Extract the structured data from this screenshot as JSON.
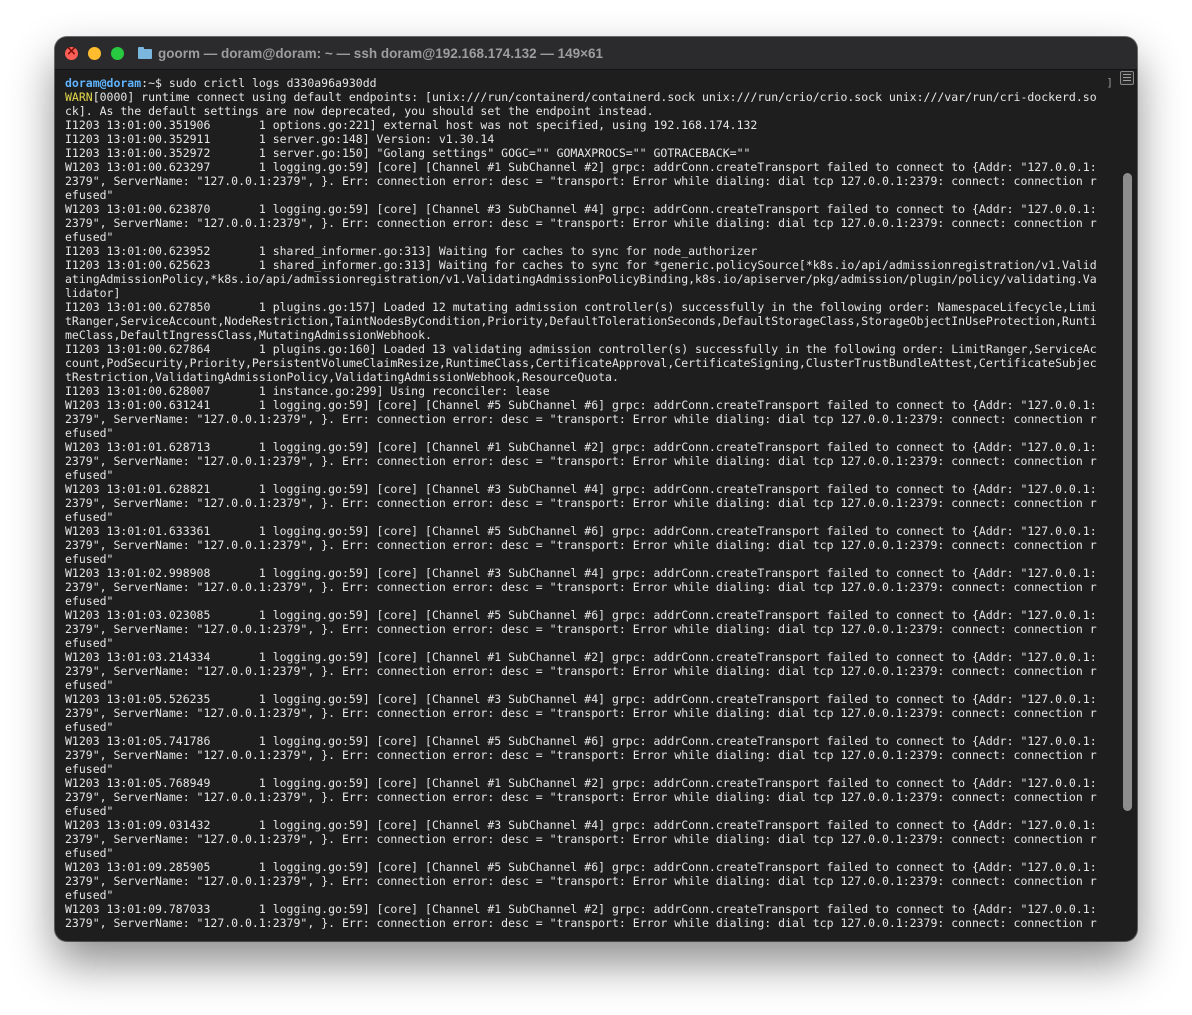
{
  "window": {
    "title": "goorm — doram@doram: ~ — ssh doram@192.168.174.132 — 149×61"
  },
  "terminal": {
    "prompt": {
      "user": "doram@doram",
      "rest": ":~$ sudo crictl logs d330a96a930dd"
    },
    "lines": [
      {
        "text": "WARN[0000] runtime connect using default endpoints: [unix:///run/containerd/containerd.sock unix:///run/crio/crio.sock unix:///var/run/cri-dockerd.so",
        "warn_prefix": "WARN",
        "rest": "[0000] runtime connect using default endpoints: [unix:///run/containerd/containerd.sock unix:///run/crio/crio.sock unix:///var/run/cri-dockerd.so"
      },
      {
        "text": "ck]. As the default settings are now deprecated, you should set the endpoint instead."
      },
      {
        "text": "I1203 13:01:00.351906       1 options.go:221] external host was not specified, using 192.168.174.132"
      },
      {
        "text": "I1203 13:01:00.352911       1 server.go:148] Version: v1.30.14"
      },
      {
        "text": "I1203 13:01:00.352972       1 server.go:150] \"Golang settings\" GOGC=\"\" GOMAXPROCS=\"\" GOTRACEBACK=\"\""
      },
      {
        "text": "W1203 13:01:00.623297       1 logging.go:59] [core] [Channel #1 SubChannel #2] grpc: addrConn.createTransport failed to connect to {Addr: \"127.0.0.1:"
      },
      {
        "text": "2379\", ServerName: \"127.0.0.1:2379\", }. Err: connection error: desc = \"transport: Error while dialing: dial tcp 127.0.0.1:2379: connect: connection r"
      },
      {
        "text": "efused\""
      },
      {
        "text": "W1203 13:01:00.623870       1 logging.go:59] [core] [Channel #3 SubChannel #4] grpc: addrConn.createTransport failed to connect to {Addr: \"127.0.0.1:"
      },
      {
        "text": "2379\", ServerName: \"127.0.0.1:2379\", }. Err: connection error: desc = \"transport: Error while dialing: dial tcp 127.0.0.1:2379: connect: connection r"
      },
      {
        "text": "efused\""
      },
      {
        "text": "I1203 13:01:00.623952       1 shared_informer.go:313] Waiting for caches to sync for node_authorizer"
      },
      {
        "text": "I1203 13:01:00.625623       1 shared_informer.go:313] Waiting for caches to sync for *generic.policySource[*k8s.io/api/admissionregistration/v1.Valid"
      },
      {
        "text": "atingAdmissionPolicy,*k8s.io/api/admissionregistration/v1.ValidatingAdmissionPolicyBinding,k8s.io/apiserver/pkg/admission/plugin/policy/validating.Va"
      },
      {
        "text": "lidator]"
      },
      {
        "text": "I1203 13:01:00.627850       1 plugins.go:157] Loaded 12 mutating admission controller(s) successfully in the following order: NamespaceLifecycle,Limi"
      },
      {
        "text": "tRanger,ServiceAccount,NodeRestriction,TaintNodesByCondition,Priority,DefaultTolerationSeconds,DefaultStorageClass,StorageObjectInUseProtection,Runti"
      },
      {
        "text": "meClass,DefaultIngressClass,MutatingAdmissionWebhook."
      },
      {
        "text": "I1203 13:01:00.627864       1 plugins.go:160] Loaded 13 validating admission controller(s) successfully in the following order: LimitRanger,ServiceAc"
      },
      {
        "text": "count,PodSecurity,Priority,PersistentVolumeClaimResize,RuntimeClass,CertificateApproval,CertificateSigning,ClusterTrustBundleAttest,CertificateSubjec"
      },
      {
        "text": "tRestriction,ValidatingAdmissionPolicy,ValidatingAdmissionWebhook,ResourceQuota."
      },
      {
        "text": "I1203 13:01:00.628007       1 instance.go:299] Using reconciler: lease"
      },
      {
        "text": "W1203 13:01:00.631241       1 logging.go:59] [core] [Channel #5 SubChannel #6] grpc: addrConn.createTransport failed to connect to {Addr: \"127.0.0.1:"
      },
      {
        "text": "2379\", ServerName: \"127.0.0.1:2379\", }. Err: connection error: desc = \"transport: Error while dialing: dial tcp 127.0.0.1:2379: connect: connection r"
      },
      {
        "text": "efused\""
      },
      {
        "text": "W1203 13:01:01.628713       1 logging.go:59] [core] [Channel #1 SubChannel #2] grpc: addrConn.createTransport failed to connect to {Addr: \"127.0.0.1:"
      },
      {
        "text": "2379\", ServerName: \"127.0.0.1:2379\", }. Err: connection error: desc = \"transport: Error while dialing: dial tcp 127.0.0.1:2379: connect: connection r"
      },
      {
        "text": "efused\""
      },
      {
        "text": "W1203 13:01:01.628821       1 logging.go:59] [core] [Channel #3 SubChannel #4] grpc: addrConn.createTransport failed to connect to {Addr: \"127.0.0.1:"
      },
      {
        "text": "2379\", ServerName: \"127.0.0.1:2379\", }. Err: connection error: desc = \"transport: Error while dialing: dial tcp 127.0.0.1:2379: connect: connection r"
      },
      {
        "text": "efused\""
      },
      {
        "text": "W1203 13:01:01.633361       1 logging.go:59] [core] [Channel #5 SubChannel #6] grpc: addrConn.createTransport failed to connect to {Addr: \"127.0.0.1:"
      },
      {
        "text": "2379\", ServerName: \"127.0.0.1:2379\", }. Err: connection error: desc = \"transport: Error while dialing: dial tcp 127.0.0.1:2379: connect: connection r"
      },
      {
        "text": "efused\""
      },
      {
        "text": "W1203 13:01:02.998908       1 logging.go:59] [core] [Channel #3 SubChannel #4] grpc: addrConn.createTransport failed to connect to {Addr: \"127.0.0.1:"
      },
      {
        "text": "2379\", ServerName: \"127.0.0.1:2379\", }. Err: connection error: desc = \"transport: Error while dialing: dial tcp 127.0.0.1:2379: connect: connection r"
      },
      {
        "text": "efused\""
      },
      {
        "text": "W1203 13:01:03.023085       1 logging.go:59] [core] [Channel #5 SubChannel #6] grpc: addrConn.createTransport failed to connect to {Addr: \"127.0.0.1:"
      },
      {
        "text": "2379\", ServerName: \"127.0.0.1:2379\", }. Err: connection error: desc = \"transport: Error while dialing: dial tcp 127.0.0.1:2379: connect: connection r"
      },
      {
        "text": "efused\""
      },
      {
        "text": "W1203 13:01:03.214334       1 logging.go:59] [core] [Channel #1 SubChannel #2] grpc: addrConn.createTransport failed to connect to {Addr: \"127.0.0.1:"
      },
      {
        "text": "2379\", ServerName: \"127.0.0.1:2379\", }. Err: connection error: desc = \"transport: Error while dialing: dial tcp 127.0.0.1:2379: connect: connection r"
      },
      {
        "text": "efused\""
      },
      {
        "text": "W1203 13:01:05.526235       1 logging.go:59] [core] [Channel #3 SubChannel #4] grpc: addrConn.createTransport failed to connect to {Addr: \"127.0.0.1:"
      },
      {
        "text": "2379\", ServerName: \"127.0.0.1:2379\", }. Err: connection error: desc = \"transport: Error while dialing: dial tcp 127.0.0.1:2379: connect: connection r"
      },
      {
        "text": "efused\""
      },
      {
        "text": "W1203 13:01:05.741786       1 logging.go:59] [core] [Channel #5 SubChannel #6] grpc: addrConn.createTransport failed to connect to {Addr: \"127.0.0.1:"
      },
      {
        "text": "2379\", ServerName: \"127.0.0.1:2379\", }. Err: connection error: desc = \"transport: Error while dialing: dial tcp 127.0.0.1:2379: connect: connection r"
      },
      {
        "text": "efused\""
      },
      {
        "text": "W1203 13:01:05.768949       1 logging.go:59] [core] [Channel #1 SubChannel #2] grpc: addrConn.createTransport failed to connect to {Addr: \"127.0.0.1:"
      },
      {
        "text": "2379\", ServerName: \"127.0.0.1:2379\", }. Err: connection error: desc = \"transport: Error while dialing: dial tcp 127.0.0.1:2379: connect: connection r"
      },
      {
        "text": "efused\""
      },
      {
        "text": "W1203 13:01:09.031432       1 logging.go:59] [core] [Channel #3 SubChannel #4] grpc: addrConn.createTransport failed to connect to {Addr: \"127.0.0.1:"
      },
      {
        "text": "2379\", ServerName: \"127.0.0.1:2379\", }. Err: connection error: desc = \"transport: Error while dialing: dial tcp 127.0.0.1:2379: connect: connection r"
      },
      {
        "text": "efused\""
      },
      {
        "text": "W1203 13:01:09.285905       1 logging.go:59] [core] [Channel #5 SubChannel #6] grpc: addrConn.createTransport failed to connect to {Addr: \"127.0.0.1:"
      },
      {
        "text": "2379\", ServerName: \"127.0.0.1:2379\", }. Err: connection error: desc = \"transport: Error while dialing: dial tcp 127.0.0.1:2379: connect: connection r"
      },
      {
        "text": "efused\""
      },
      {
        "text": "W1203 13:01:09.787033       1 logging.go:59] [core] [Channel #1 SubChannel #2] grpc: addrConn.createTransport failed to connect to {Addr: \"127.0.0.1:"
      },
      {
        "text": "2379\", ServerName: \"127.0.0.1:2379\", }. Err: connection error: desc = \"transport: Error while dialing: dial tcp 127.0.0.1:2379: connect: connection r"
      }
    ]
  },
  "scrollbar": {
    "visible_fraction": 0.73
  },
  "icons": {
    "close": "close-icon",
    "minimize": "minimize-icon",
    "maximize": "maximize-icon",
    "folder": "folder-icon",
    "scrollback": "scrollback-icon"
  },
  "colors": {
    "close": "#ff5f57",
    "minimize": "#febc2e",
    "maximize": "#28c840",
    "prompt_user": "#5fb3ff",
    "warn": "#e5d84a",
    "text": "#e6e6e6",
    "background": "#1e1e1e"
  }
}
